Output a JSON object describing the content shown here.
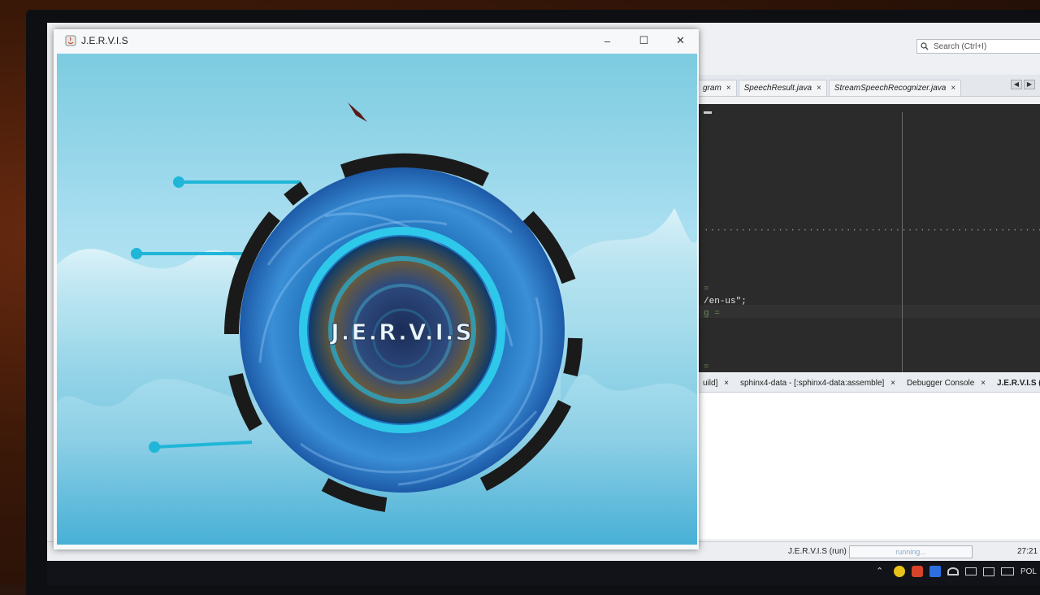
{
  "window": {
    "title": "J.E.R.V.I.S",
    "logo_text": "J.E.R.V.I.S",
    "controls": {
      "minimize": "–",
      "maximize": "☐",
      "close": "✕"
    }
  },
  "ide": {
    "search_placeholder": "Search (Ctrl+I)",
    "tabs": [
      {
        "label": "gram"
      },
      {
        "label": "SpeechResult.java"
      },
      {
        "label": "StreamSpeechRecognizer.java"
      }
    ],
    "code": {
      "line1": "=",
      "line2": "/en-us\";",
      "line3": "g =",
      "line4": "="
    },
    "output_tabs": [
      {
        "label": "uild]"
      },
      {
        "label": "sphinx4-data - [:sphinx4-data:assemble]"
      },
      {
        "label": "Debugger Console"
      },
      {
        "label": "J.E.R.V.I.S (run)"
      }
    ],
    "tab_close": "×"
  },
  "status": {
    "run_label": "J.E.R.V.I.S (run)",
    "progress_text": "running...",
    "time": "27:21",
    "lang": "POL"
  },
  "colors": {
    "accent": "#1fb6d8",
    "editor_bg": "#2b2b2b",
    "logo_blue": "#1e6fb8"
  }
}
